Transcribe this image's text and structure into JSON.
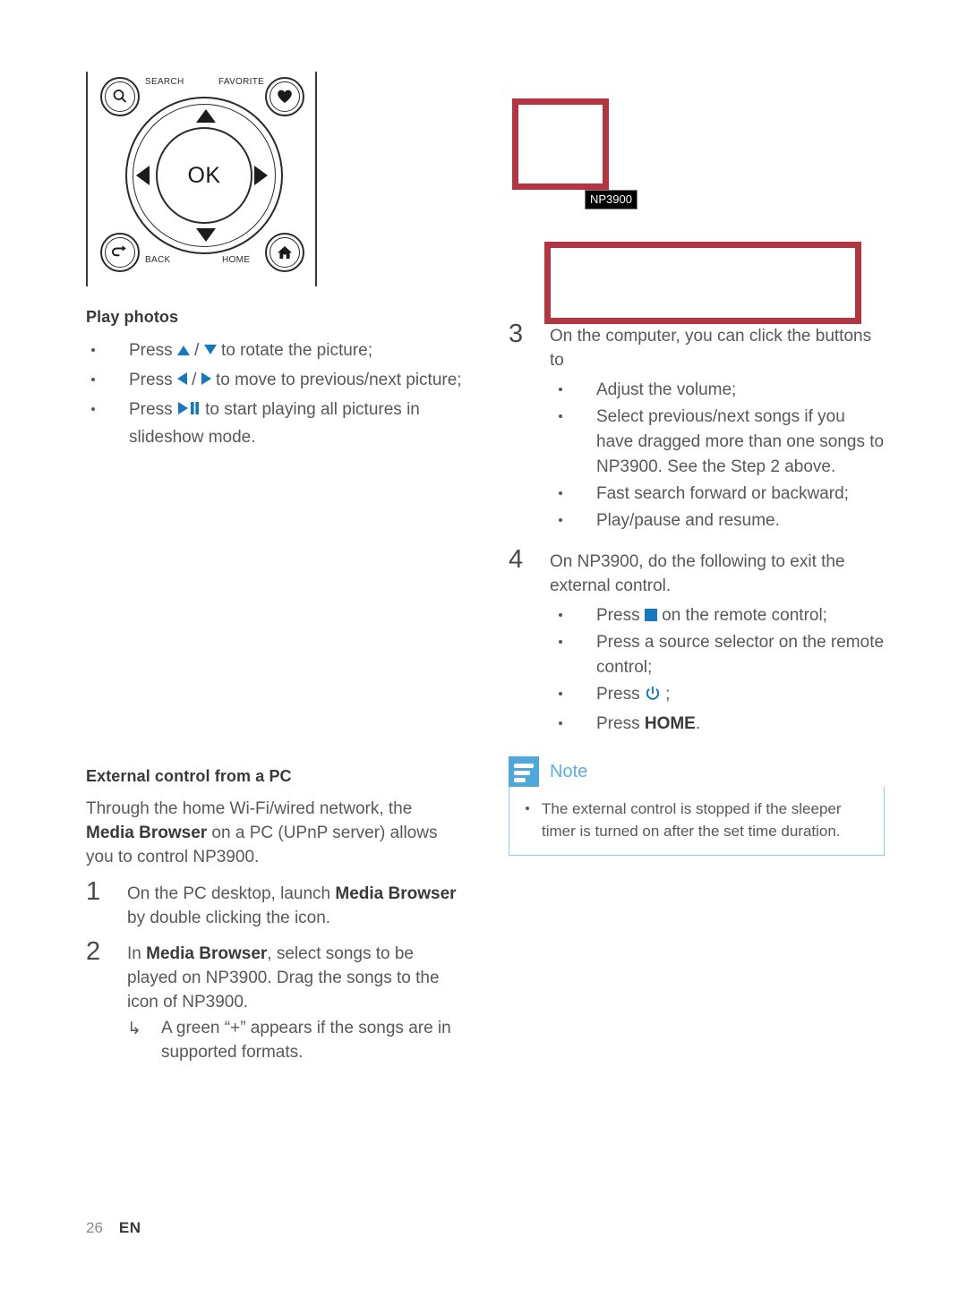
{
  "remote": {
    "ok_label": "OK",
    "search_label": "SEARCH",
    "favorite_label": "FAVORITE",
    "back_label": "BACK",
    "home_label": "HOME"
  },
  "left_column": {
    "play_photos": {
      "heading": "Play photos",
      "bullets": [
        {
          "pre": "Press ",
          "sym1": "up-triangle",
          "mid": " / ",
          "sym2": "down-triangle",
          "post": " to rotate the picture;"
        },
        {
          "pre": "Press ",
          "sym1": "left-triangle",
          "mid": " / ",
          "sym2": "right-triangle",
          "post": " to move to previous/next picture;"
        },
        {
          "pre": "Press ",
          "sym1": "play-pause",
          "mid": "",
          "sym2": "",
          "post": " to start playing all pictures in slideshow mode."
        }
      ]
    },
    "external_control": {
      "heading": "External control from a PC",
      "intro_part1": "Through the home Wi-Fi/wired network, the ",
      "intro_bold1": "Media Browser",
      "intro_part2": " on a PC (UPnP server) allows you to control NP3900.",
      "steps": [
        {
          "num": "1",
          "part1": "On the PC desktop, launch ",
          "bold1": "Media Browser",
          "part2": " by double clicking the icon."
        },
        {
          "num": "2",
          "part1": "In ",
          "bold1": "Media Browser",
          "part2": ", select songs to be played on NP3900. Drag the songs to the icon of NP3900.",
          "hook_items": [
            {
              "marker": "↳",
              "text": "A green “+” appears if the songs are in supported formats."
            }
          ]
        }
      ]
    }
  },
  "right_column": {
    "figure": {
      "np_tag": "NP3900",
      "box_color": "#b33540"
    },
    "steps": [
      {
        "num": "3",
        "text": "On the computer, you can click the buttons to",
        "sub_bullets": [
          {
            "text": "Adjust the volume;"
          },
          {
            "text": "Select previous/next songs if you have dragged more than one songs to NP3900. See the Step 2 above."
          },
          {
            "text": "Fast search forward or backward;"
          },
          {
            "text": "Play/pause and resume."
          }
        ]
      },
      {
        "num": "4",
        "text": "On NP3900, do the following to exit the external control.",
        "sub_bullets": [
          {
            "pre": "Press ",
            "symbol": "stop-square",
            "post": " on the remote control;"
          },
          {
            "text": "Press a source selector on the remote control;"
          },
          {
            "pre": "Press ",
            "symbol": "power-icon",
            "post": " ;"
          },
          {
            "pre": "Press ",
            "bold": "HOME",
            "post": "."
          }
        ]
      }
    ],
    "note": {
      "title": "Note",
      "accent_color": "#4fa8dc",
      "items": [
        "The external control is stopped if the sleeper timer is turned on after the set time duration."
      ]
    }
  },
  "footer": {
    "page_number": "26",
    "language": "EN"
  }
}
